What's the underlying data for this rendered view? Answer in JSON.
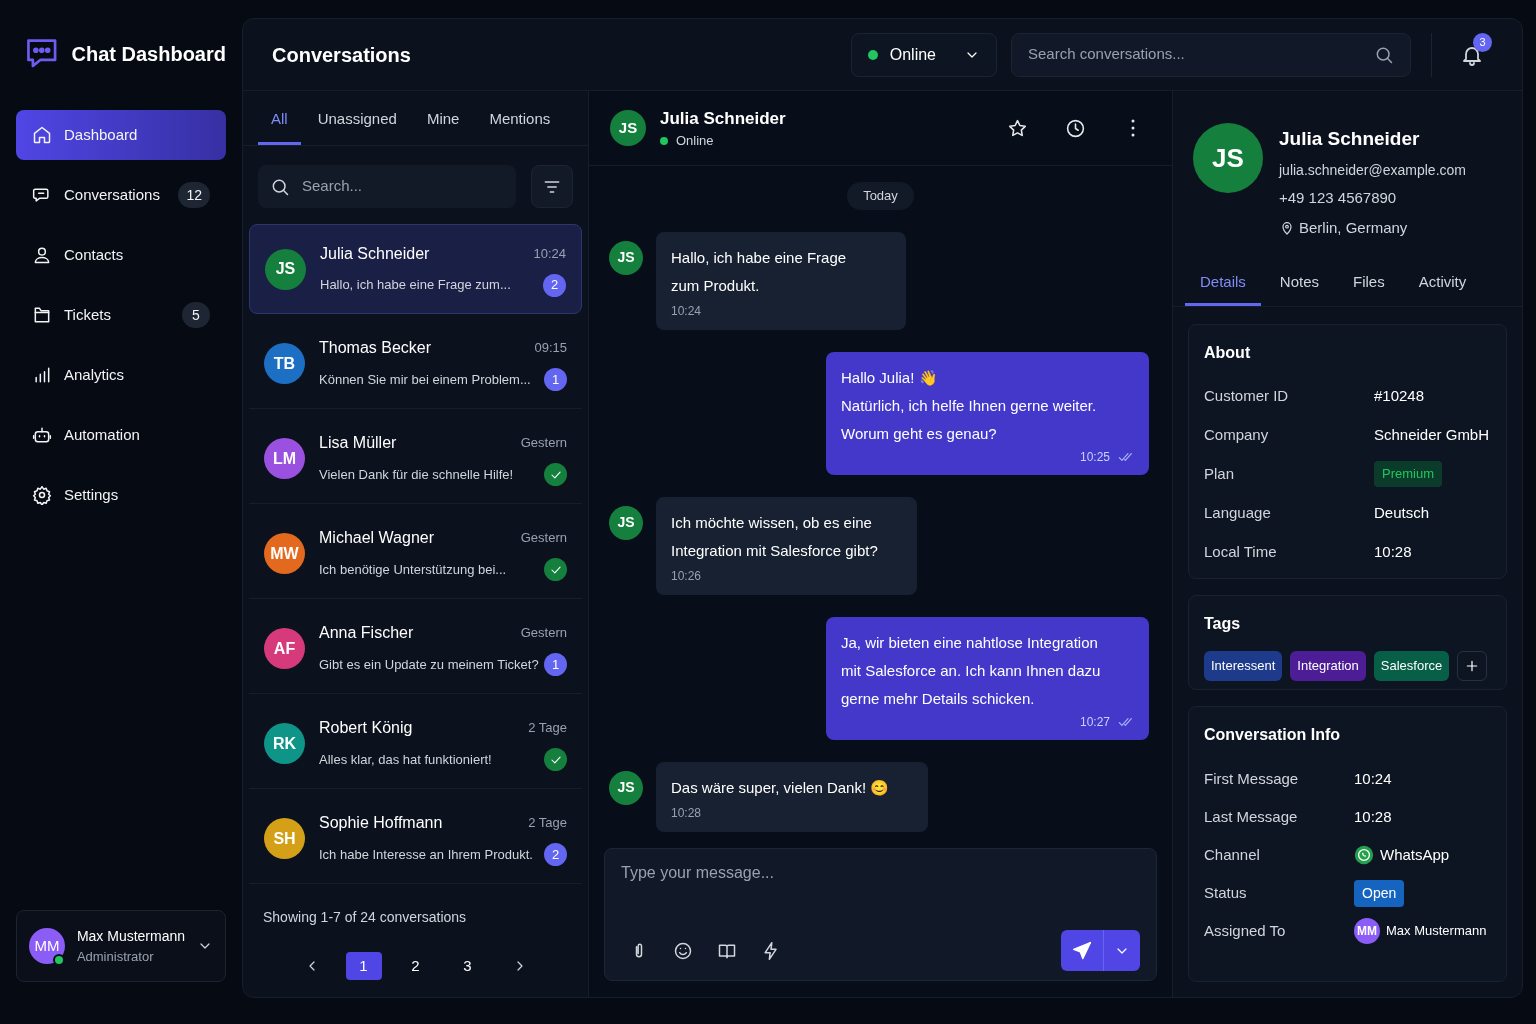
{
  "app": {
    "title": "Chat Dashboard"
  },
  "nav": [
    {
      "label": "Dashboard",
      "selected": true
    },
    {
      "label": "Conversations",
      "badge": "12",
      "selected": false
    },
    {
      "label": "Contacts",
      "selected": false
    },
    {
      "label": "Tickets",
      "badge": "5",
      "selected": false
    },
    {
      "label": "Analytics",
      "selected": false
    },
    {
      "label": "Automation",
      "selected": false
    },
    {
      "label": "Settings",
      "selected": false
    }
  ],
  "user": {
    "initials": "MM",
    "name": "Max Mustermann",
    "role": "Administrator",
    "online": true
  },
  "header": {
    "title": "Conversations",
    "status": "Online",
    "search_placeholder": "Search conversations...",
    "notifications": "3"
  },
  "conversation_tabs": [
    {
      "label": "All",
      "selected": true
    },
    {
      "label": "Unassigned",
      "selected": false
    },
    {
      "label": "Mine",
      "selected": false
    },
    {
      "label": "Mentions",
      "selected": false
    }
  ],
  "list_search": {
    "placeholder": "Search..."
  },
  "conversations": [
    {
      "initials": "JS",
      "color": "#15803d",
      "name": "Julia Schneider",
      "time": "10:24",
      "preview": "Hallo, ich habe eine Frage zum...",
      "kind": "unread",
      "count": "2",
      "selected": true
    },
    {
      "initials": "TB",
      "color": "#1d6fc4",
      "name": "Thomas Becker",
      "time": "09:15",
      "preview": "Können Sie mir bei einem Problem...",
      "kind": "unread",
      "count": "1",
      "selected": false
    },
    {
      "initials": "LM",
      "color": "#9b51e0",
      "name": "Lisa Müller",
      "time": "Gestern",
      "preview": "Vielen Dank für die schnelle Hilfe!",
      "kind": "resolved",
      "selected": false
    },
    {
      "initials": "MW",
      "color": "#e2691d",
      "name": "Michael Wagner",
      "time": "Gestern",
      "preview": "Ich benötige Unterstützung bei...",
      "kind": "resolved",
      "selected": false
    },
    {
      "initials": "AF",
      "color": "#d63a7a",
      "name": "Anna Fischer",
      "time": "Gestern",
      "preview": "Gibt es ein Update zu meinem Ticket?",
      "kind": "unread",
      "count": "1",
      "selected": false
    },
    {
      "initials": "RK",
      "color": "#0f9488",
      "name": "Robert König",
      "time": "2 Tage",
      "preview": "Alles klar, das hat funktioniert!",
      "kind": "resolved",
      "selected": false
    },
    {
      "initials": "SH",
      "color": "#d4a017",
      "name": "Sophie Hoffmann",
      "time": "2 Tage",
      "preview": "Ich habe Interesse an Ihrem Produkt.",
      "kind": "unread",
      "count": "2",
      "selected": false
    }
  ],
  "pagination": {
    "summary": "Showing 1-7 of 24 conversations",
    "pages": [
      {
        "label": "1",
        "selected": true
      },
      {
        "label": "2",
        "selected": false
      },
      {
        "label": "3",
        "selected": false
      }
    ]
  },
  "chat": {
    "initials": "JS",
    "color": "#15803d",
    "name": "Julia Schneider",
    "presence": "Online",
    "date": "Today",
    "messages": [
      {
        "kind": "incoming",
        "initials": "JS",
        "color": "#15803d",
        "text": "Hallo, ich habe eine Frage\nzum Produkt.",
        "time": "10:24"
      },
      {
        "kind": "outgoing",
        "text": "Hallo Julia! 👋\nNatürlich, ich helfe Ihnen gerne weiter.\nWorum geht es genau?",
        "time": "10:25",
        "read": true
      },
      {
        "kind": "incoming",
        "initials": "JS",
        "color": "#15803d",
        "text": "Ich möchte wissen, ob es eine\nIntegration mit Salesforce gibt?",
        "time": "10:26"
      },
      {
        "kind": "outgoing",
        "text": "Ja, wir bieten eine nahtlose Integration\nmit Salesforce an. Ich kann Ihnen dazu\ngerne mehr Details schicken.",
        "time": "10:27",
        "read": true
      },
      {
        "kind": "incoming",
        "initials": "JS",
        "color": "#15803d",
        "text": "Das wäre super, vielen Dank! 😊",
        "time": "10:28"
      }
    ],
    "composer_placeholder": "Type your message..."
  },
  "contact": {
    "initials": "JS",
    "color": "#15803d",
    "name": "Julia Schneider",
    "email": "julia.schneider@example.com",
    "phone": "+49 123 4567890",
    "location": "Berlin, Germany",
    "tabs": [
      {
        "label": "Details",
        "selected": true
      },
      {
        "label": "Notes",
        "selected": false
      },
      {
        "label": "Files",
        "selected": false
      },
      {
        "label": "Activity",
        "selected": false
      }
    ],
    "about": {
      "title": "About",
      "rows": [
        {
          "label": "Customer ID",
          "value": "#10248",
          "kind": "text"
        },
        {
          "label": "Company",
          "value": "Schneider GmbH",
          "kind": "text"
        },
        {
          "label": "Plan",
          "value": "Premium",
          "kind": "plan"
        },
        {
          "label": "Language",
          "value": "Deutsch",
          "kind": "text"
        },
        {
          "label": "Local Time",
          "value": "10:28",
          "kind": "text"
        }
      ]
    },
    "tags": {
      "title": "Tags",
      "items": [
        {
          "label": "Interessent",
          "color": "#1e3a8a"
        },
        {
          "label": "Integration",
          "color": "#4c1d95"
        },
        {
          "label": "Salesforce",
          "color": "#065f46"
        }
      ]
    },
    "info": {
      "title": "Conversation Info",
      "rows": [
        {
          "label": "First Message",
          "value": "10:24",
          "kind": "text"
        },
        {
          "label": "Last Message",
          "value": "10:28",
          "kind": "text"
        },
        {
          "label": "Channel",
          "value": "WhatsApp",
          "kind": "channel"
        },
        {
          "label": "Status",
          "value": "Open",
          "kind": "status"
        },
        {
          "label": "Assigned To",
          "value": "Max Mustermann",
          "initials": "MM",
          "kind": "user"
        }
      ]
    }
  }
}
